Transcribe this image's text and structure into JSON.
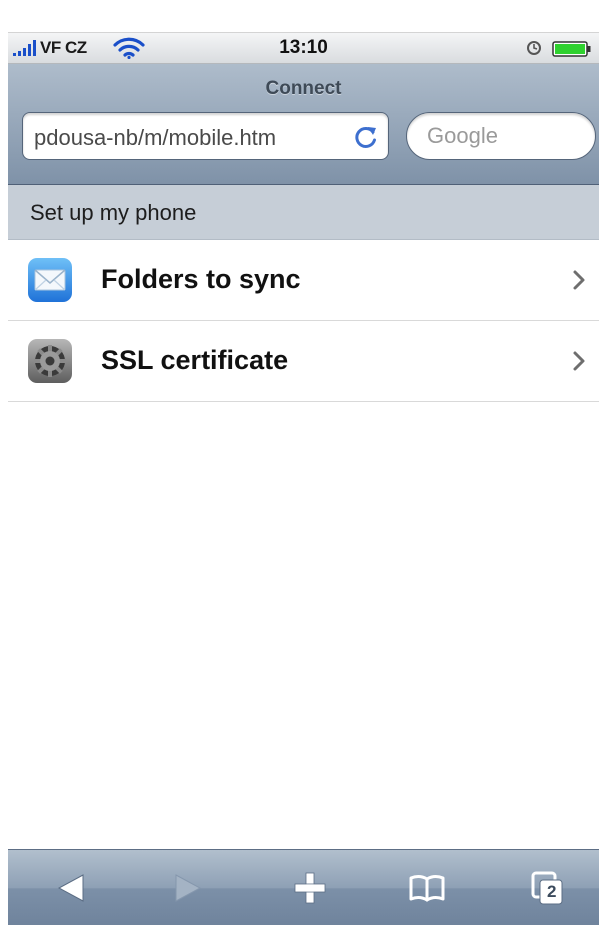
{
  "status_bar": {
    "carrier": "VF CZ",
    "time": "13:10",
    "signal_icon": "signal-bars-icon",
    "wifi_icon": "wifi-icon",
    "lock_icon": "orientation-lock-icon",
    "battery_icon": "battery-icon",
    "battery_color": "#2fd12f"
  },
  "nav": {
    "title": "Connect",
    "url": "pdousa-nb/m/mobile.htm",
    "reload_icon": "reload-icon",
    "search_placeholder": "Google"
  },
  "section": {
    "title": "Set up my phone"
  },
  "list": {
    "items": [
      {
        "label": "Folders to sync",
        "icon": "mail-icon"
      },
      {
        "label": "SSL certificate",
        "icon": "settings-gear-icon"
      }
    ]
  },
  "toolbar": {
    "buttons": [
      {
        "name": "back",
        "icon": "back-arrow-icon"
      },
      {
        "name": "forward",
        "icon": "forward-arrow-icon"
      },
      {
        "name": "add",
        "icon": "plus-icon"
      },
      {
        "name": "bookmarks",
        "icon": "book-icon"
      },
      {
        "name": "pages",
        "icon": "pages-icon"
      }
    ],
    "pages_count": "2"
  },
  "colors": {
    "nav_bar": "#8fa1b6",
    "section_header": "#c6ced7",
    "toolbar": "#8ea0b5"
  }
}
